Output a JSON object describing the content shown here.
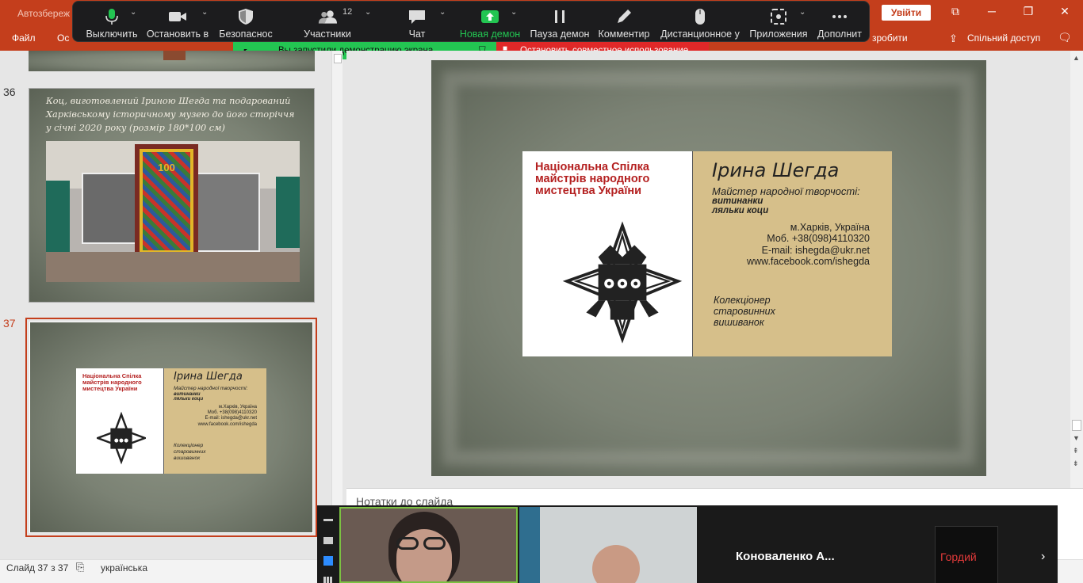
{
  "ppt": {
    "autosave_label": "Автозбереж",
    "signin": "Увійти",
    "menu_file": "Файл",
    "menu_os": "Ос",
    "menu_right": "зробити",
    "share": "Спільний доступ"
  },
  "zoom_toolbar": {
    "mute": "Выключить",
    "stop_video": "Остановить в",
    "security": "Безопаснос",
    "participants": "Участники",
    "participants_count": "12",
    "chat": "Чат",
    "new_share": "Новая демон",
    "pause_share": "Пауза демон",
    "annotate": "Комментир",
    "remote_control": "Дистанционное у",
    "apps": "Приложения",
    "more": "Дополнит"
  },
  "share_bar": {
    "sharing_text": "Вы запустили демонстрацию экрана",
    "stop_text": "Остановить совместное использование"
  },
  "thumbnails": {
    "slide36_num": "36",
    "slide36_caption": "Коц, виготовлений Іриною Шегда та подарований Харківському історичному музею до його сторіччя у січні 2020 року (розмір 180*100 см)",
    "slide37_num": "37"
  },
  "card": {
    "org": "Національна Спілка майстрів народного мистецтва України",
    "name": "Ірина Шегда",
    "title": "Майстер народної творчості:",
    "crafts": "витинанки ляльки коци",
    "city": "м.Харків, Україна",
    "phone": "Моб. +38(098)4110320",
    "email": "E-mail: ishegda@ukr.net",
    "web": "www.facebook.com/ishegda",
    "collector": "Колекціонер старовинних вишиванок"
  },
  "notes": {
    "label": "Нотатки до слайда"
  },
  "status": {
    "slide_counter": "Слайд 37 з 37",
    "language": "українська"
  },
  "video": {
    "participant3": "Коноваленко А...",
    "participant4_logo": "Гордий"
  },
  "colors": {
    "ppt_accent": "#c43e1c",
    "zoom_green": "#23c552",
    "zoom_red": "#e02828",
    "card_tan": "#d6bf8a"
  }
}
